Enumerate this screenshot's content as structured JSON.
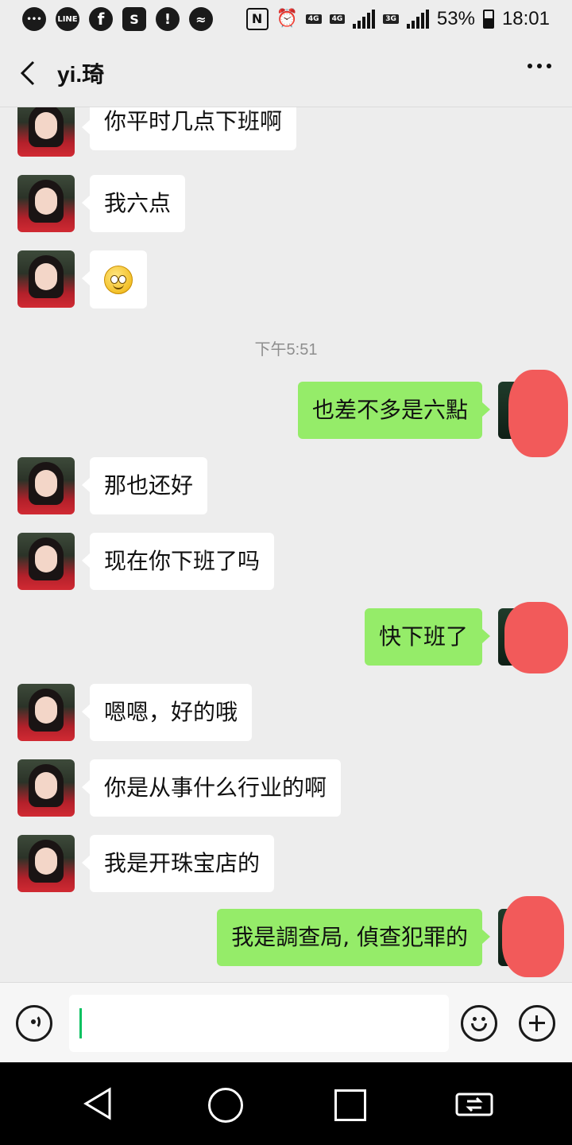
{
  "status_bar": {
    "left_icons": [
      "chat-bubble-icon",
      "line-app-icon",
      "facebook-icon",
      "shopee-icon",
      "alarm-alert-icon",
      "messenger-icon"
    ],
    "line_label": "LINE",
    "nfc_label": "N",
    "net_4g_a": "4G",
    "net_4g_b": "4G",
    "net_3g": "3G",
    "battery": "53%",
    "battery_level": 0.53,
    "time": "18:01"
  },
  "header": {
    "title": "yi.琦"
  },
  "messages": [
    {
      "side": "in",
      "text": "你平时几点下班啊"
    },
    {
      "side": "in",
      "text": "我六点"
    },
    {
      "side": "in",
      "emoji": "smile-emoji"
    },
    {
      "timestamp": "下午5:51"
    },
    {
      "side": "out",
      "text": "也差不多是六點"
    },
    {
      "side": "in",
      "text": "那也还好"
    },
    {
      "side": "in",
      "text": "现在你下班了吗"
    },
    {
      "side": "out",
      "text": "快下班了"
    },
    {
      "side": "in",
      "text": "嗯嗯，好的哦"
    },
    {
      "side": "in",
      "text": "你是从事什么行业的啊"
    },
    {
      "side": "in",
      "text": "我是开珠宝店的"
    },
    {
      "side": "out",
      "text": "我是調查局, 偵查犯罪的"
    }
  ],
  "input": {
    "placeholder": ""
  },
  "colors": {
    "background": "#ededed",
    "incoming_bubble": "#ffffff",
    "outgoing_bubble": "#95ec69",
    "redaction": "#f25a5a",
    "caret": "#07c160"
  }
}
